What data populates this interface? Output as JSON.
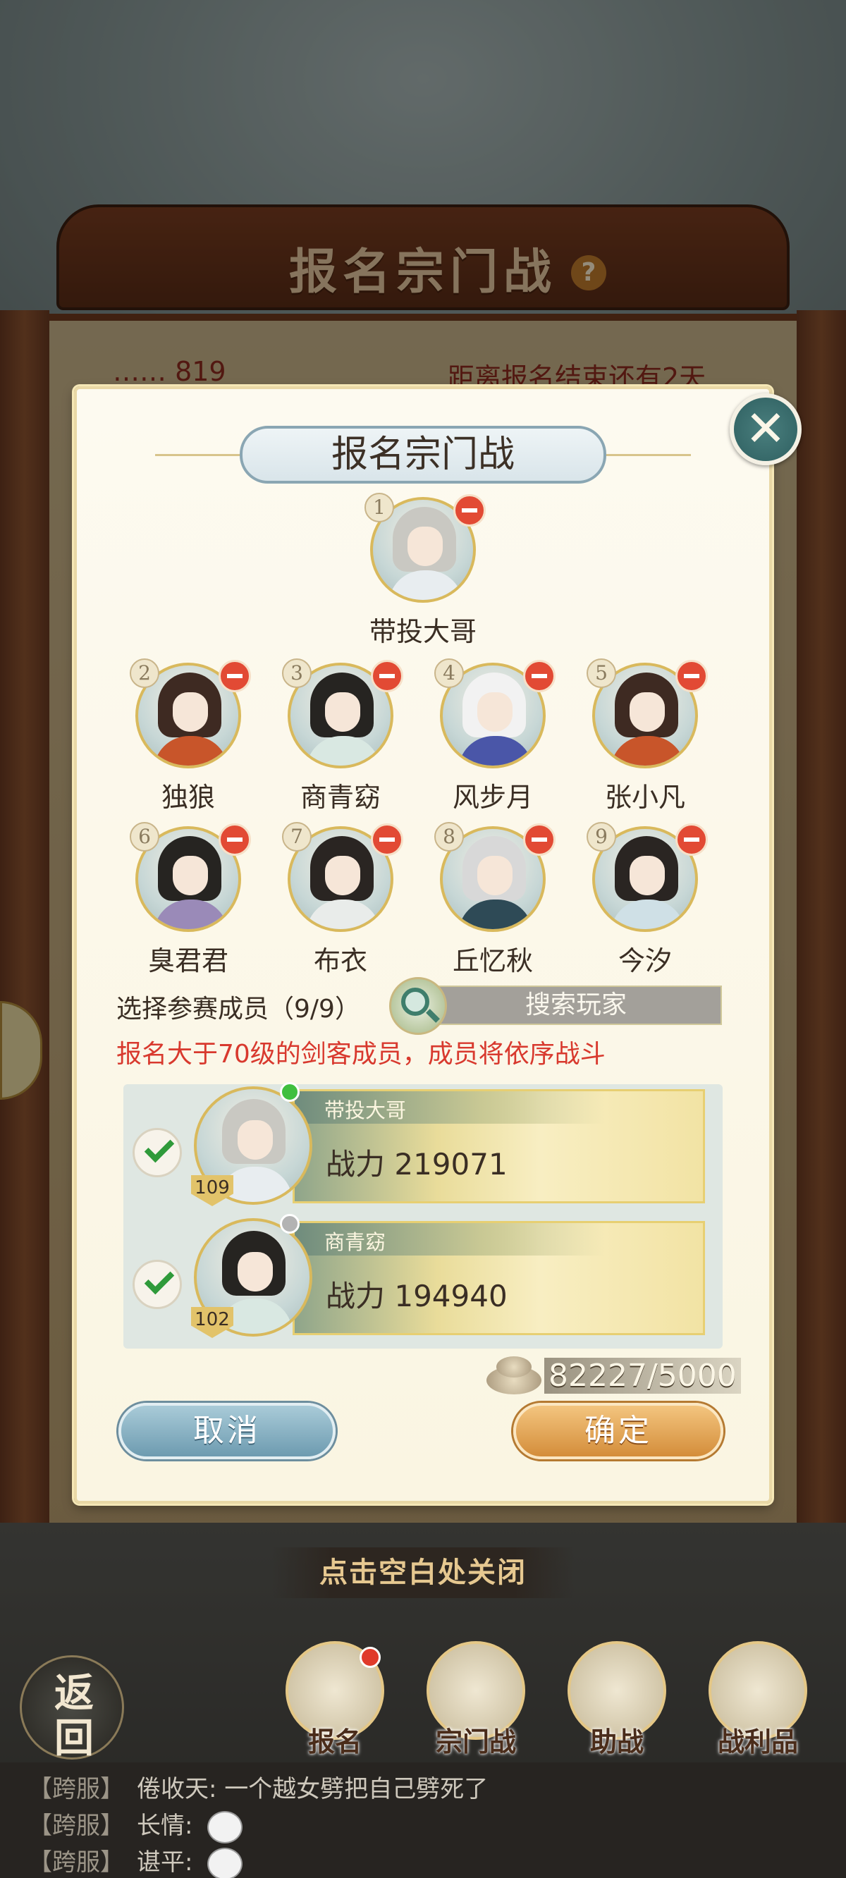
{
  "background": {
    "banner_title": "报名宗门战",
    "info_left": "…… 819",
    "info_right": "距离报名结束还有2天"
  },
  "dialog": {
    "title": "报名宗门战",
    "team": [
      {
        "index": "1",
        "name": "带投大哥",
        "hair": "#c9c8c2",
        "robe": "#e8edf0"
      },
      {
        "index": "2",
        "name": "独狼",
        "hair": "#3e2a22",
        "robe": "#c8552a"
      },
      {
        "index": "3",
        "name": "商青窈",
        "hair": "#262421",
        "robe": "#d9e8e2"
      },
      {
        "index": "4",
        "name": "风步月",
        "hair": "#f2f2f2",
        "robe": "#4a56a8"
      },
      {
        "index": "5",
        "name": "张小凡",
        "hair": "#3e2a22",
        "robe": "#c8552a"
      },
      {
        "index": "6",
        "name": "臭君君",
        "hair": "#262421",
        "robe": "#9a8ab8"
      },
      {
        "index": "7",
        "name": "布衣",
        "hair": "#2a2522",
        "robe": "#e9ecea"
      },
      {
        "index": "8",
        "name": "丘忆秋",
        "hair": "#d8d8d8",
        "robe": "#2e4a56"
      },
      {
        "index": "9",
        "name": "今汐",
        "hair": "#2a2522",
        "robe": "#cfe0e6"
      }
    ],
    "select_label": "选择参赛成员（9/9）",
    "search_placeholder": "搜索玩家",
    "hint": "报名大于70级的剑客成员，成员将依序战斗",
    "members": [
      {
        "name": "带投大哥",
        "power": "战力 219071",
        "level": "109",
        "online_color": "#3fbf3f",
        "hair": "#c9c8c2",
        "robe": "#e8edf0"
      },
      {
        "name": "商青窈",
        "power": "战力 194940",
        "level": "102",
        "online_color": "#b3b3b3",
        "hair": "#262421",
        "robe": "#d9e8e2"
      }
    ],
    "currency": "82227/5000",
    "cancel_label": "取消",
    "confirm_label": "确定"
  },
  "close_hint": "点击空白处关闭",
  "back_label_1": "返",
  "back_label_2": "回",
  "nav": [
    {
      "label": "报名",
      "icon": "scroll-brush-icon"
    },
    {
      "label": "宗门战",
      "icon": "mountain-flag-icon"
    },
    {
      "label": "助战",
      "icon": "handshake-icon"
    },
    {
      "label": "战利品",
      "icon": "treasure-chest-icon"
    }
  ],
  "chat": [
    {
      "tag": "【跨服】",
      "text": "倦收天: 一个越女劈把自己劈死了"
    },
    {
      "tag": "【跨服】",
      "text": "长情: "
    },
    {
      "tag": "【跨服】",
      "text": "谌平: "
    }
  ]
}
